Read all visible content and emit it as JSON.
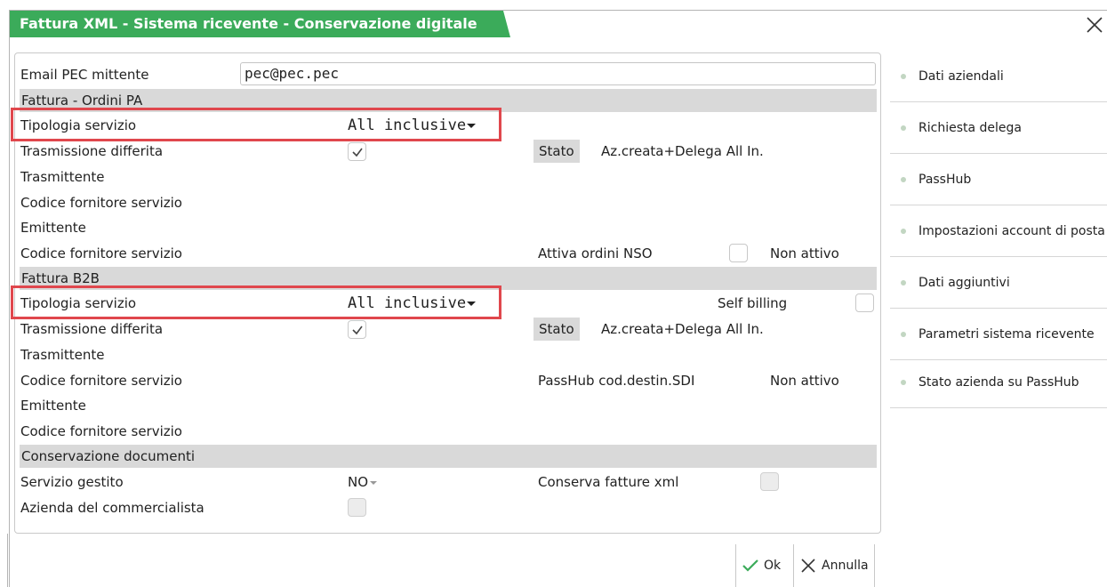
{
  "window": {
    "title": "Fattura XML - Sistema ricevente - Conservazione digitale"
  },
  "form": {
    "email": {
      "label": "Email PEC mittente",
      "value": "pec@pec.pec"
    },
    "pa": {
      "section": "Fattura - Ordini PA",
      "tipologia_label": "Tipologia servizio",
      "tipologia_value": "All inclusive",
      "trasm_label": "Trasmissione differita",
      "trasm_checked": true,
      "stato_label": "Stato",
      "stato_value": "Az.creata+Delega All In.",
      "trasmittente": "Trasmittente",
      "codice1": "Codice fornitore servizio",
      "emittente": "Emittente",
      "codice2": "Codice fornitore servizio",
      "nso_label": "Attiva ordini NSO",
      "nso_state": "Non attivo"
    },
    "b2b": {
      "section": "Fattura B2B",
      "tipologia_label": "Tipologia servizio",
      "tipologia_value": "All inclusive",
      "self_billing_label": "Self billing",
      "trasm_label": "Trasmissione differita",
      "trasm_checked": true,
      "stato_label": "Stato",
      "stato_value": "Az.creata+Delega All In.",
      "trasmittente": "Trasmittente",
      "codice1": "Codice fornitore servizio",
      "passhub_label": "PassHub cod.destin.SDI",
      "passhub_state": "Non attivo",
      "emittente": "Emittente",
      "codice2": "Codice fornitore servizio"
    },
    "cons": {
      "section": "Conservazione documenti",
      "servizio_label": "Servizio gestito",
      "servizio_value": "NO",
      "conserva_label": "Conserva fatture xml",
      "azienda_label": "Azienda del commercialista"
    }
  },
  "sidebar": {
    "items": [
      {
        "label": "Dati aziendali"
      },
      {
        "label": "Richiesta delega"
      },
      {
        "label": "PassHub"
      },
      {
        "label": "Impostazioni account di posta"
      },
      {
        "label": "Dati aggiuntivi"
      },
      {
        "label": "Parametri sistema ricevente"
      },
      {
        "label": "Stato azienda su PassHub"
      }
    ]
  },
  "buttons": {
    "ok": "Ok",
    "annulla": "Annulla"
  },
  "colors": {
    "title_bar": "#3bab5a",
    "highlight": "#e0474d",
    "section_bg": "#d9d9d9",
    "ok_check": "#3bab5a"
  },
  "icons": [
    "close-icon",
    "checkmark-icon",
    "ok-check-icon",
    "annulla-x-icon",
    "dropdown-caret-icon"
  ]
}
